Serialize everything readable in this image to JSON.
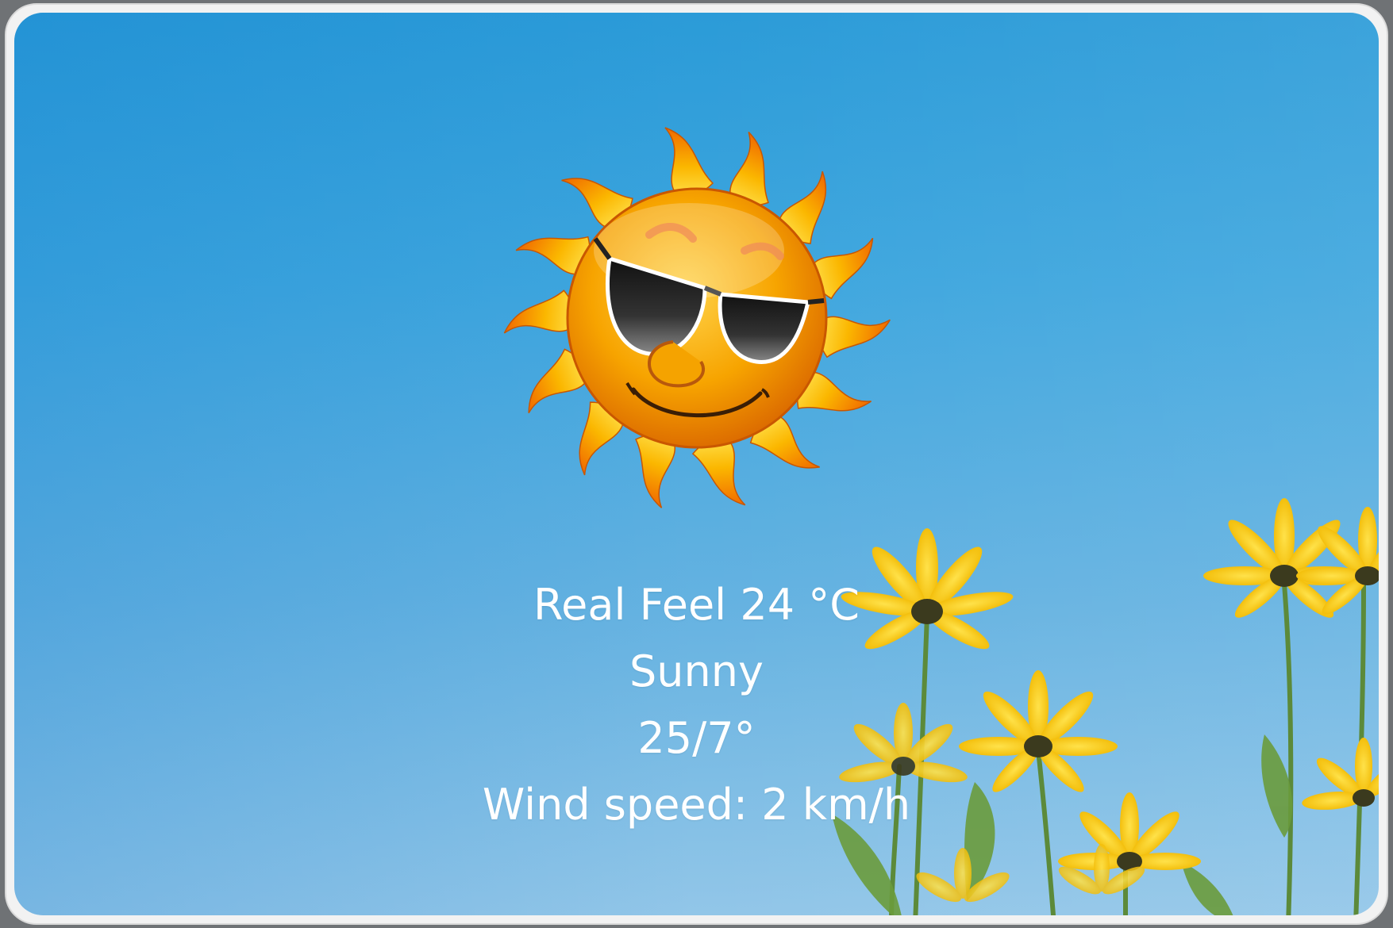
{
  "weather": {
    "real_feel": "Real Feel 24 °C",
    "condition": "Sunny",
    "temp_range": "25/7°",
    "wind": "Wind speed: 2 km/h"
  },
  "icon": "sun-with-sunglasses-icon",
  "colors": {
    "sky_top": "#2b9bd8",
    "sky_bottom": "#92c6e8",
    "text": "#ffffff",
    "sun_body": "#f7a400",
    "flower_petal": "#f6c800"
  }
}
